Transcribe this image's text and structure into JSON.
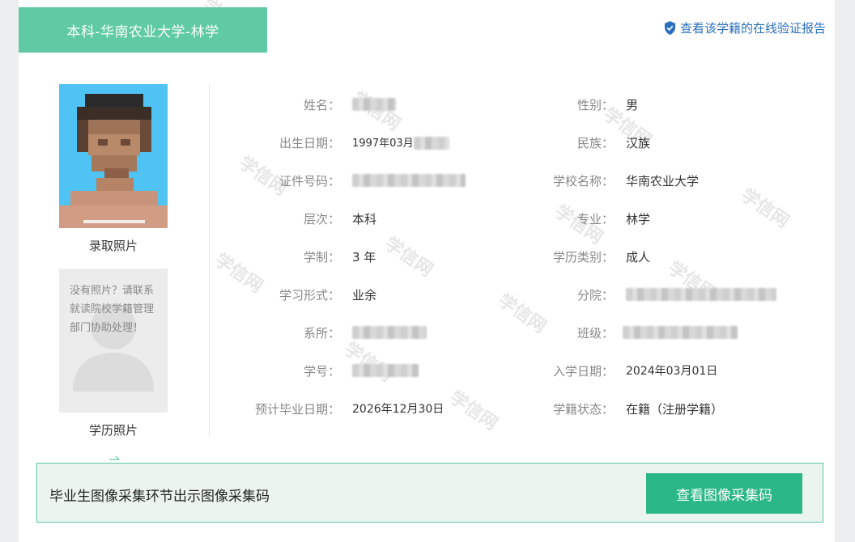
{
  "header": {
    "title": "本科-华南农业大学-林学",
    "verify_link": "查看该学籍的在线验证报告"
  },
  "watermark_text": "学信网",
  "photos": {
    "admission_caption": "录取照片",
    "education_caption": "学历照片",
    "no_photo_message": "没有照片？请联系就读院校学籍管理部门协助处理！"
  },
  "fields_left": [
    {
      "label": "姓名：",
      "value": "",
      "redacted": true
    },
    {
      "label": "出生日期：",
      "value": "1997年03月",
      "redacted": true
    },
    {
      "label": "证件号码：",
      "value": "",
      "redacted": true
    },
    {
      "label": "层次：",
      "value": "本科"
    },
    {
      "label": "学制：",
      "value": "3 年"
    },
    {
      "label": "学习形式：",
      "value": "业余"
    },
    {
      "label": "系所：",
      "value": "",
      "redacted": true
    },
    {
      "label": "学号：",
      "value": "",
      "redacted": true
    },
    {
      "label": "预计毕业日期：",
      "value": "2026年12月30日"
    }
  ],
  "fields_right": [
    {
      "label": "性别：",
      "value": "男"
    },
    {
      "label": "民族：",
      "value": "汉族"
    },
    {
      "label": "学校名称：",
      "value": "华南农业大学"
    },
    {
      "label": "专业：",
      "value": "林学"
    },
    {
      "label": "学历类别：",
      "value": "成人"
    },
    {
      "label": "分院：",
      "value": "",
      "redacted": true
    },
    {
      "label": "班级：",
      "value": "",
      "redacted": true
    },
    {
      "label": "入学日期：",
      "value": "2024年03月01日"
    },
    {
      "label": "学籍状态：",
      "value": "在籍（注册学籍）"
    }
  ],
  "banner": {
    "text": "毕业生图像采集环节出示图像采集码",
    "button": "查看图像采集码"
  },
  "colors": {
    "accent": "#5fcaa3",
    "button": "#2bb787",
    "link": "#2a6fbd"
  }
}
